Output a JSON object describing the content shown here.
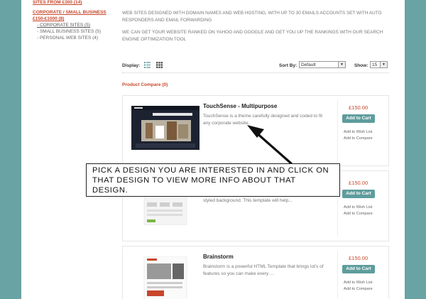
{
  "sidebar": {
    "top_link": "SITES FROM £300 (14)",
    "group_title_line1": "CORPORATE / SMALL BUSINESS",
    "group_title_line2": "£150-£1000 (8)",
    "sub_items": [
      {
        "label": "- CORPORATE SITES (5)",
        "active": true
      },
      {
        "label": "- SMALL BUSINESS SITES (5)",
        "active": false
      },
      {
        "label": "- PERSONAL WEB SITES (4)",
        "active": false
      }
    ]
  },
  "intro": {
    "line1": "WEB SITES DESIGNED WITH DOMAIN NAMES AND WEB HOSTING, WITH UP TO 30  EMAILS ACCOUNTS SET WITH AUTO RESPONDERS AND EMAIL FORWARDING",
    "line2": "WE CAN GET YOUR WEBSITE RANKED  ON YAHOO AND GOOGLE AND GET YOU UP THE RANKINGS WITH OUR SEARCH ENGINE OPTIMIZATION TOOL"
  },
  "toolbar": {
    "display_label": "Display:",
    "sort_label": "Sort By:",
    "sort_value": "Default",
    "show_label": "Show:",
    "show_value": "15",
    "dropdown_arrow": "▼"
  },
  "compare_label": "Product Compare (0)",
  "products": [
    {
      "name": "TouchSense - Multipurpose",
      "description": "TouchSense is a theme carefully designed and coded to fit any corporate website.",
      "price": "£150.00",
      "cart_label": "Add to Cart",
      "wish_label": "Add to Wish List",
      "compare_label": "Add to Compare"
    },
    {
      "name": "",
      "description": "styled background. This template will help...",
      "price": "£150.00",
      "cart_label": "Add to Cart",
      "wish_label": "Add to Wish List",
      "compare_label": "Add to Compare"
    },
    {
      "name": "Brainstorm",
      "description": "Brainstorm is a powerful HTML Template that brings lot's of features so you can make every ...",
      "price": "£150.00",
      "cart_label": "Add to Cart",
      "wish_label": "Add to Wish List",
      "compare_label": "Add to Compare"
    }
  ],
  "callout": {
    "text": "Pick a design you are interested in and click on that design to view more info about that design."
  },
  "colors": {
    "accent": "#c8472b",
    "button": "#5e9c9c",
    "background": "#6aa3a3"
  }
}
